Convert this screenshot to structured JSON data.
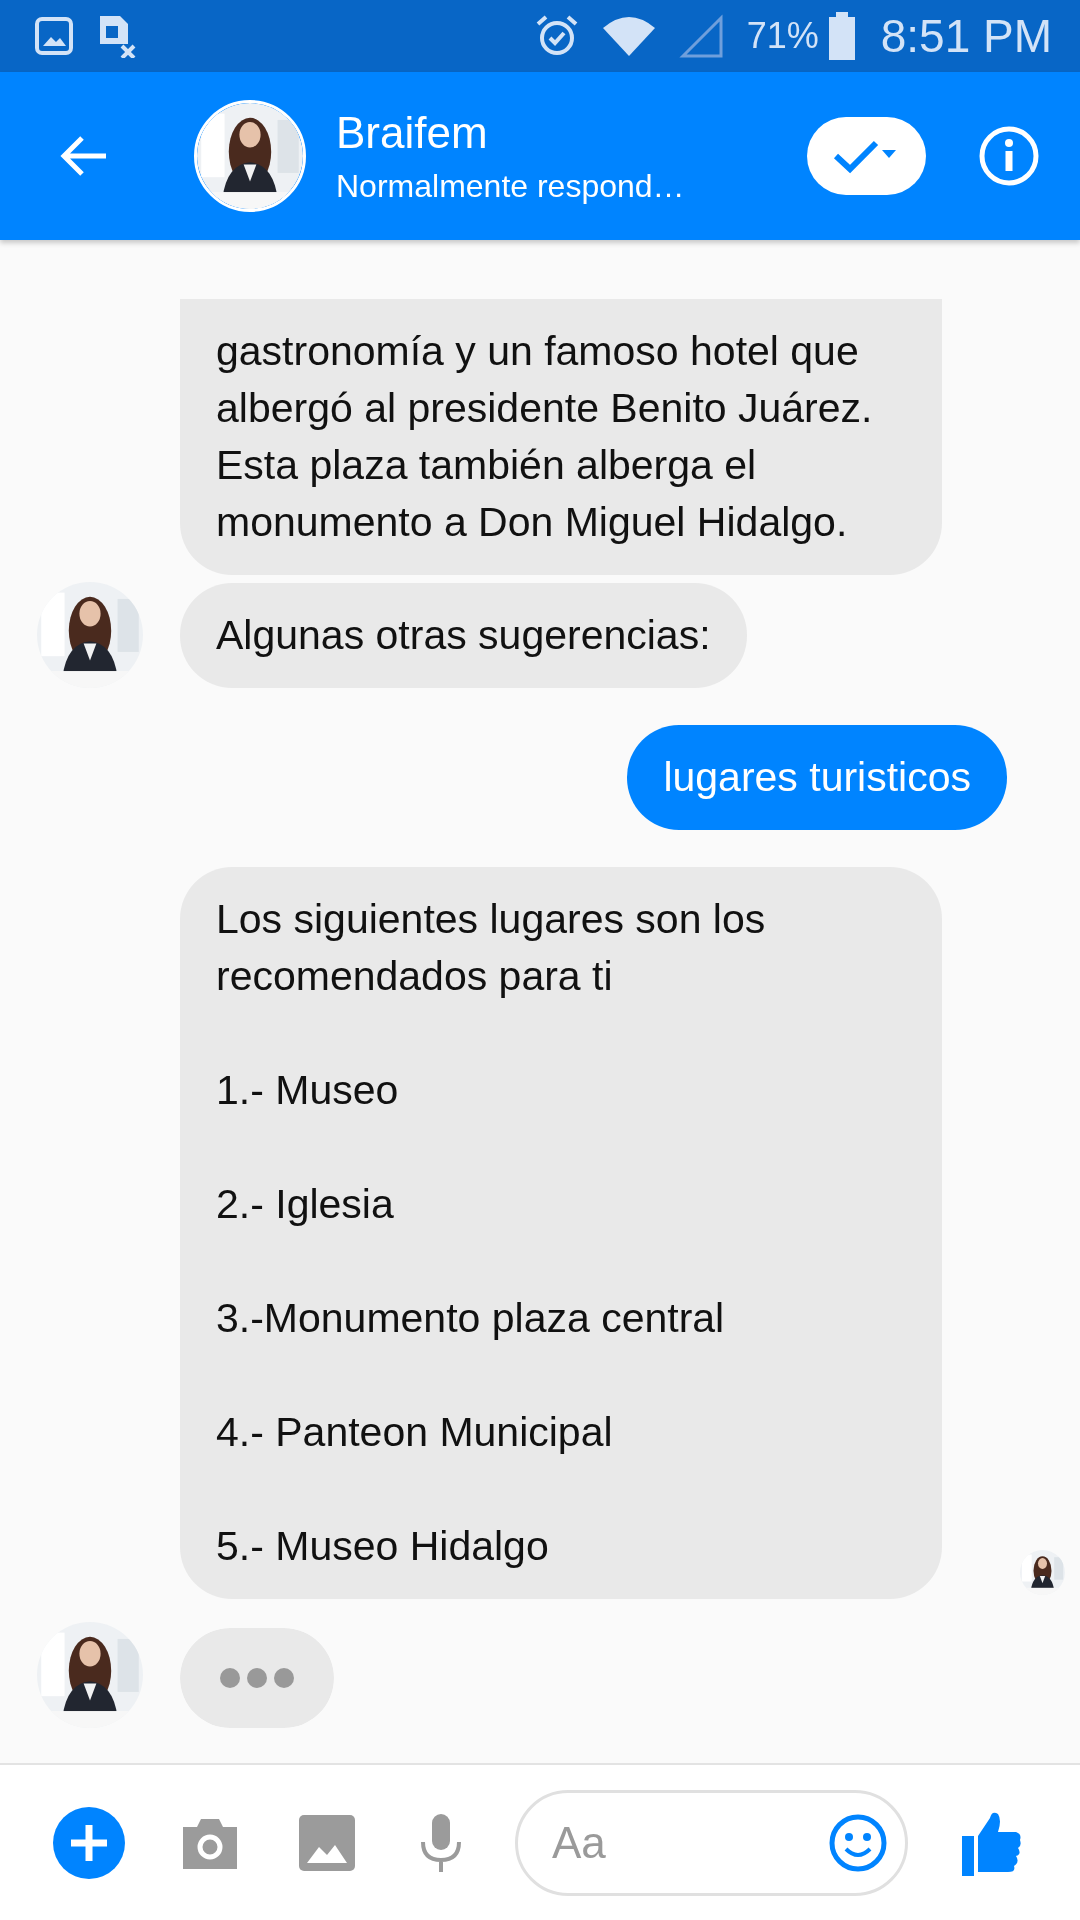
{
  "status_bar": {
    "battery_percent": "71%",
    "time": "8:51 PM"
  },
  "header": {
    "title": "Braifem",
    "subtitle": "Normalmente respond…"
  },
  "messages": [
    {
      "kind": "incoming",
      "text": "gastronomía y un famoso hotel que albergó al presidente Benito Juárez. Esta plaza también alberga el monumento a Don Miguel Hidalgo.",
      "show_avatar": false,
      "seen": false
    },
    {
      "kind": "incoming",
      "text": "Algunas otras sugerencias:",
      "show_avatar": true,
      "seen": false
    },
    {
      "kind": "outgoing",
      "text": "lugares turisticos"
    },
    {
      "kind": "incoming",
      "text": "Los siguientes lugares son los recomendados para ti\n\n1.- Museo\n\n2.- Iglesia\n\n3.-Monumento plaza central\n\n4.- Panteon Municipal\n\n5.- Museo Hidalgo",
      "show_avatar": false,
      "seen": true
    },
    {
      "kind": "typing",
      "show_avatar": true
    }
  ],
  "composer": {
    "placeholder": "Aa"
  }
}
